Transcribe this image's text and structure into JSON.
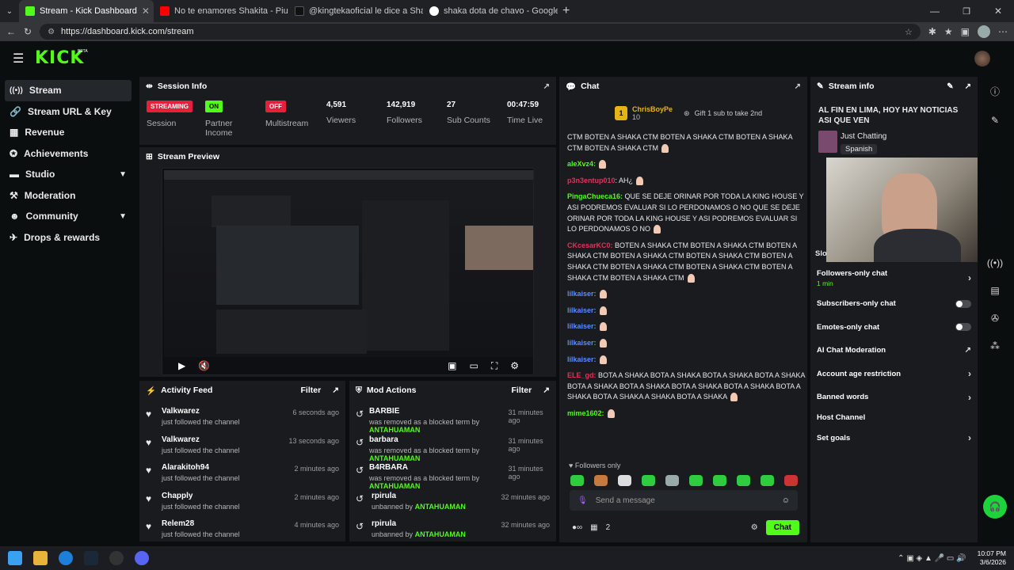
{
  "browser": {
    "tabs": [
      {
        "title": "Stream - Kick Dashboard",
        "color": "#53fc18"
      },
      {
        "title": "No te enamores Shakita - Piurano",
        "color": "#ff0000"
      },
      {
        "title": "@kingtekaoficial le dice a Shaka q",
        "color": "#111111"
      },
      {
        "title": "shaka dota de chavo - Google Sea",
        "color": "#4285f4"
      }
    ],
    "url": "https://dashboard.kick.com/stream"
  },
  "app": {
    "logo": "KICK",
    "logo_badge": "BETA"
  },
  "sidebar": {
    "items": [
      {
        "label": "Stream",
        "icon": "stream-icon"
      },
      {
        "label": "Stream URL & Key",
        "icon": "link-icon"
      },
      {
        "label": "Revenue",
        "icon": "revenue-icon"
      },
      {
        "label": "Achievements",
        "icon": "achievements-icon"
      },
      {
        "label": "Studio",
        "icon": "studio-icon"
      },
      {
        "label": "Moderation",
        "icon": "moderation-icon"
      },
      {
        "label": "Community",
        "icon": "community-icon"
      },
      {
        "label": "Drops & rewards",
        "icon": "drops-icon"
      }
    ]
  },
  "session": {
    "title": "Session Info",
    "status_badge": "STREAMING",
    "status_label": "Session",
    "partner_badge": "ON",
    "partner_label": "Partner Income",
    "multistream_badge": "OFF",
    "multistream_label": "Multistream",
    "viewers": "4,591",
    "viewers_label": "Viewers",
    "followers": "142,919",
    "followers_label": "Followers",
    "subs": "27",
    "subs_label": "Sub Counts",
    "time": "00:47:59",
    "time_label": "Time Live"
  },
  "preview": {
    "title": "Stream Preview"
  },
  "activity": {
    "title": "Activity Feed",
    "filter": "Filter",
    "items": [
      {
        "name": "Valkwarez",
        "text": "just followed the channel",
        "time": "6 seconds ago"
      },
      {
        "name": "Valkwarez",
        "text": "just followed the channel",
        "time": "13 seconds ago"
      },
      {
        "name": "Alarakitoh94",
        "text": "just followed the channel",
        "time": "2 minutes ago"
      },
      {
        "name": "Chapply",
        "text": "just followed the channel",
        "time": "2 minutes ago"
      },
      {
        "name": "Relem28",
        "text": "just followed the channel",
        "time": "4 minutes ago"
      }
    ]
  },
  "mod": {
    "title": "Mod Actions",
    "filter": "Filter",
    "items": [
      {
        "name": "BARBIE",
        "text": "was removed as a blocked term by",
        "by": "ANTAHUAMAN",
        "time": "31 minutes ago"
      },
      {
        "name": "barbara",
        "text": "was removed as a blocked term by",
        "by": "ANTAHUAMAN",
        "time": "31 minutes ago"
      },
      {
        "name": "B4RBARA",
        "text": "was removed as a blocked term by",
        "by": "ANTAHUAMAN",
        "time": "31 minutes ago"
      },
      {
        "name": "rpirula",
        "text": "unbanned by",
        "by": "ANTAHUAMAN",
        "time": "32 minutes ago"
      },
      {
        "name": "rpirula",
        "text": "unbanned by",
        "by": "ANTAHUAMAN",
        "time": "32 minutes ago"
      }
    ]
  },
  "chat": {
    "title": "Chat",
    "pinned_user": "ChrisBoyPe",
    "pinned_count": "10",
    "pinned_rank": "1",
    "pinned_gift": "Gift 1 sub to take 2nd",
    "followers_only": "Followers only",
    "placeholder": "Send a message",
    "user_count": "2",
    "send": "Chat",
    "messages": [
      {
        "user": "",
        "color": "#e8eaeb",
        "text": "CTM  BOTEN A SHAKA CTM  BOTEN A SHAKA CTM  BOTEN A SHAKA CTM  BOTEN A SHAKA CTM"
      },
      {
        "user": "aleXvz4:",
        "color": "#53fc18",
        "text": ""
      },
      {
        "user": "p3n3entup010",
        "color": "#e0325a",
        "text": ": AH¿"
      },
      {
        "user": "PingaChueca16:",
        "color": "#53fc18",
        "text": " QUE SE DEJE ORINAR POR TODA LA KING HOUSE Y ASI PODREMOS EVALUAR SI LO PERDONAMOS O NO  QUE SE DEJE ORINAR POR TODA LA KING HOUSE Y ASI PODREMOS EVALUAR SI LO PERDONAMOS O NO"
      },
      {
        "user": "CKcesarKC0:",
        "color": "#e0325a",
        "text": " BOTEN A SHAKA CTM  BOTEN A SHAKA CTM  BOTEN A SHAKA CTM  BOTEN A SHAKA CTM  BOTEN A SHAKA CTM  BOTEN A SHAKA CTM  BOTEN A SHAKA CTM  BOTEN A SHAKA CTM  BOTEN A SHAKA CTM  BOTEN A SHAKA CTM"
      },
      {
        "user": "lilkaiser:",
        "color": "#5b8cff",
        "text": ""
      },
      {
        "user": "lilkaiser:",
        "color": "#5b8cff",
        "text": ""
      },
      {
        "user": "lilkaiser:",
        "color": "#5b8cff",
        "text": ""
      },
      {
        "user": "lilkaiser:",
        "color": "#5b8cff",
        "text": ""
      },
      {
        "user": "lilkaiser:",
        "color": "#5b8cff",
        "text": ""
      },
      {
        "user": "ELE_gd:",
        "color": "#e0325a",
        "text": " BOTA A SHAKA  BOTA A SHAKA  BOTA A SHAKA  BOTA A SHAKA  BOTA A SHAKA  BOTA A SHAKA  BOTA A SHAKA  BOTA A SHAKA  BOTA A SHAKA  BOTA A SHAKA  A SHAKA  BOTA A SHAKA"
      },
      {
        "user": "mime1602:",
        "color": "#53fc18",
        "text": ""
      }
    ]
  },
  "stream_info": {
    "title": "Stream info",
    "stream_title": "AL FIN EN LIMA, HOY HAY NOTICIAS ASI QUE VEN",
    "category": "Just Chatting",
    "language": "Spanish",
    "slow_label": "Slo",
    "settings": [
      {
        "label": "Followers-only chat",
        "sub": "1 min",
        "control": "chevron"
      },
      {
        "label": "Subscribers-only chat",
        "sub": "",
        "control": "toggle"
      },
      {
        "label": "Emotes-only chat",
        "sub": "",
        "control": "toggle"
      },
      {
        "label": "AI Chat Moderation",
        "sub": "",
        "control": "external"
      },
      {
        "label": "Account age restriction",
        "sub": "",
        "control": "chevron"
      },
      {
        "label": "Banned words",
        "sub": "",
        "control": "chevron"
      },
      {
        "label": "Host Channel",
        "sub": "",
        "control": "none"
      },
      {
        "label": "Set goals",
        "sub": "",
        "control": "chevron"
      }
    ]
  },
  "taskbar": {
    "time": "10:07 PM",
    "date": "3/6/2026"
  },
  "colors": {
    "accent": "#53fc18",
    "danger": "#e5203b",
    "panel": "#191b1f"
  }
}
